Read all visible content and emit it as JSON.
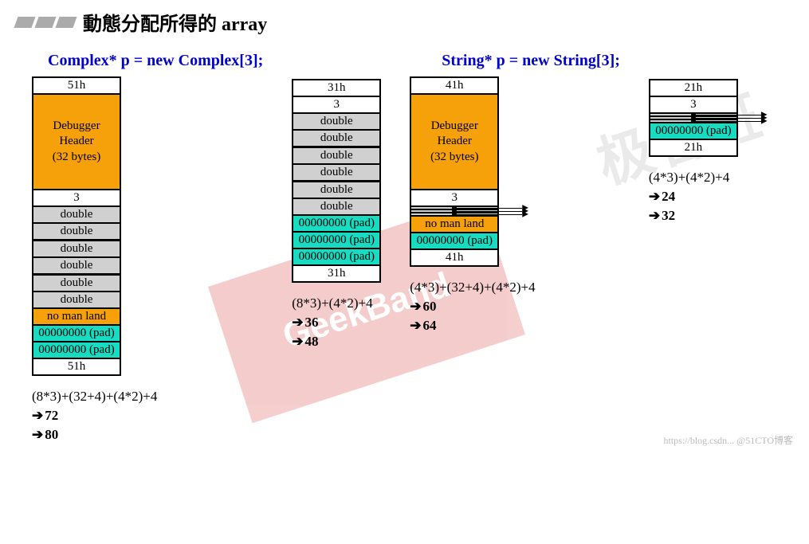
{
  "title": "動態分配所得的 array",
  "decl_left": "Complex* p = new Complex[3];",
  "decl_right": "String* p = new String[3];",
  "col1": {
    "cells": [
      "51h",
      "Debugger\nHeader\n(32 bytes)",
      "3",
      "double",
      "double",
      "double",
      "double",
      "double",
      "double",
      "no man land",
      "00000000 (pad)",
      "00000000 (pad)",
      "51h"
    ],
    "calc": [
      "(8*3)+(32+4)+(4*2)+4",
      "72",
      "80"
    ]
  },
  "col2": {
    "cells": [
      "31h",
      "3",
      "double",
      "double",
      "double",
      "double",
      "double",
      "double",
      "00000000 (pad)",
      "00000000 (pad)",
      "00000000 (pad)",
      "31h"
    ],
    "calc": [
      "(8*3)+(4*2)+4",
      "36",
      "48"
    ]
  },
  "col3": {
    "cells": [
      "41h",
      "Debugger\nHeader\n(32 bytes)",
      "3",
      "",
      "",
      "",
      "no man land",
      "00000000 (pad)",
      "41h"
    ],
    "calc": [
      "(4*3)+(32+4)+(4*2)+4",
      "60",
      "64"
    ]
  },
  "col4": {
    "cells": [
      "21h",
      "3",
      "",
      "",
      "",
      "00000000 (pad)",
      "21h"
    ],
    "calc": [
      "(4*3)+(4*2)+4",
      "24",
      "32"
    ]
  },
  "watermark1": "GeekBand",
  "watermark2": "极客班",
  "footer": "https://blog.csdn... @51CTO博客"
}
